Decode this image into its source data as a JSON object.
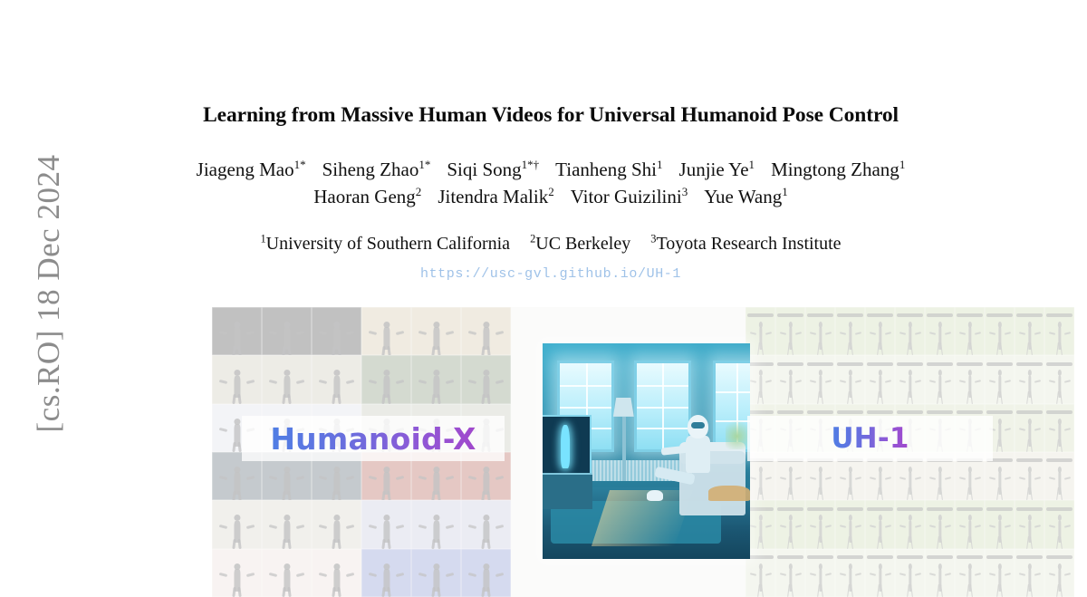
{
  "arxiv_stamp": "[cs.RO]  18 Dec 2024",
  "paper": {
    "title": "Learning from Massive Human Videos for Universal Humanoid Pose Control",
    "authors": [
      [
        {
          "name": "Jiageng Mao",
          "sup": "1*"
        },
        {
          "name": "Siheng Zhao",
          "sup": "1*"
        },
        {
          "name": "Siqi Song",
          "sup": "1*†"
        },
        {
          "name": "Tianheng Shi",
          "sup": "1"
        },
        {
          "name": "Junjie Ye",
          "sup": "1"
        },
        {
          "name": "Mingtong Zhang",
          "sup": "1"
        }
      ],
      [
        {
          "name": "Haoran Geng",
          "sup": "2"
        },
        {
          "name": "Jitendra Malik",
          "sup": "2"
        },
        {
          "name": "Vitor Guizilini",
          "sup": "3"
        },
        {
          "name": "Yue Wang",
          "sup": "1"
        }
      ]
    ],
    "affiliations": [
      {
        "sup": "1",
        "name": "University of Southern California"
      },
      {
        "sup": "2",
        "name": "UC Berkeley"
      },
      {
        "sup": "3",
        "name": "Toyota Research Institute"
      }
    ],
    "project_url": "https://usc-gvl.github.io/UH-1"
  },
  "teaser": {
    "left_label": "Humanoid-X",
    "right_label": "UH-1",
    "gradient_start_color": "#4f7ee4",
    "gradient_end_color": "#a148cc",
    "url_color": "#9fc2e8",
    "stamp_color": "#8c8c8c",
    "center_scene_caption": "Humanoid robot sitting on a couch in a teal-lit living room pointing a remote at a television showing a human figure",
    "left_collage_frames": [
      {
        "theme": "bg-dark",
        "kind": "person"
      },
      {
        "theme": "bg-dark",
        "kind": "person"
      },
      {
        "theme": "bg-dark",
        "kind": "person"
      },
      {
        "theme": "bg-suit",
        "kind": "person"
      },
      {
        "theme": "bg-suit",
        "kind": "person"
      },
      {
        "theme": "bg-suit",
        "kind": "person"
      },
      {
        "theme": "bg-cart",
        "kind": "person"
      },
      {
        "theme": "bg-cart",
        "kind": "person"
      },
      {
        "theme": "bg-cart",
        "kind": "person"
      },
      {
        "theme": "bg-gym",
        "kind": "person"
      },
      {
        "theme": "bg-gym",
        "kind": "person"
      },
      {
        "theme": "bg-gym",
        "kind": "person"
      },
      {
        "theme": "bg-court",
        "kind": "person"
      },
      {
        "theme": "bg-court",
        "kind": "person"
      },
      {
        "theme": "bg-court",
        "kind": "person"
      },
      {
        "theme": "bg-street",
        "kind": "person"
      },
      {
        "theme": "bg-street",
        "kind": "person"
      },
      {
        "theme": "bg-street",
        "kind": "person"
      },
      {
        "theme": "bg-kitchen",
        "kind": "person"
      },
      {
        "theme": "bg-kitchen",
        "kind": "person"
      },
      {
        "theme": "bg-kitchen",
        "kind": "person"
      },
      {
        "theme": "bg-track",
        "kind": "person"
      },
      {
        "theme": "bg-track",
        "kind": "person"
      },
      {
        "theme": "bg-track",
        "kind": "person"
      },
      {
        "theme": "bg-room",
        "kind": "person"
      },
      {
        "theme": "bg-room",
        "kind": "person"
      },
      {
        "theme": "bg-room",
        "kind": "person"
      },
      {
        "theme": "bg-stage",
        "kind": "person"
      },
      {
        "theme": "bg-stage",
        "kind": "person"
      },
      {
        "theme": "bg-stage",
        "kind": "person"
      },
      {
        "theme": "bg-pink",
        "kind": "person"
      },
      {
        "theme": "bg-pink",
        "kind": "person"
      },
      {
        "theme": "bg-pink",
        "kind": "person"
      },
      {
        "theme": "bg-blue",
        "kind": "person"
      },
      {
        "theme": "bg-blue",
        "kind": "person"
      },
      {
        "theme": "bg-blue",
        "kind": "person"
      }
    ],
    "right_collage_theme_rows": [
      "bg-grass",
      "bg-field",
      "bg-grass2",
      "bg-sky",
      "bg-grass",
      "bg-field"
    ]
  }
}
